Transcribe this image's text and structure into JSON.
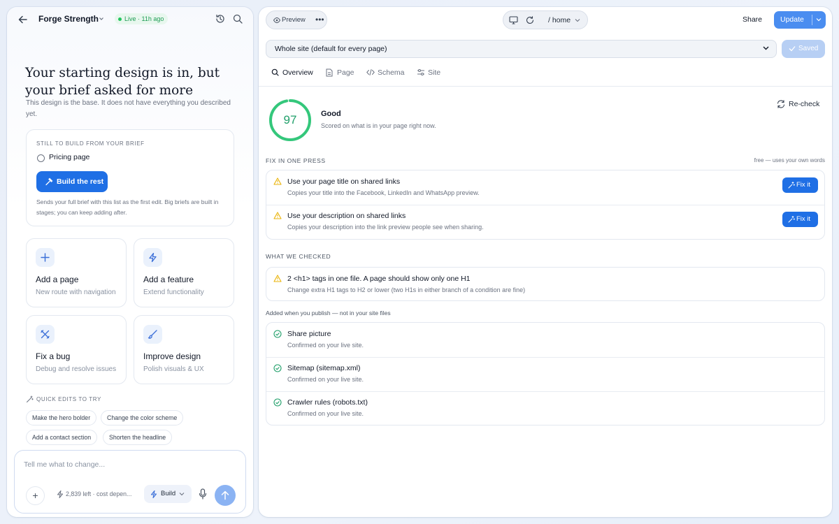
{
  "left": {
    "project_name": "Forge Strength",
    "live_badge": "Live · 11h ago",
    "heading": "Your starting design is in, but your brief asked for more",
    "subtext": "This design is the base. It does not have everything you described yet.",
    "todo": {
      "header": "STILL TO BUILD FROM YOUR BRIEF",
      "item": "Pricing page",
      "button": "Build the rest",
      "note": "Sends your full brief with this list as the first edit. Big briefs are built in stages; you can keep adding after."
    },
    "cards": [
      {
        "title": "Add a page",
        "subtitle": "New route with navigation",
        "icon": "plus-icon"
      },
      {
        "title": "Add a feature",
        "subtitle": "Extend functionality",
        "icon": "lightning-icon"
      },
      {
        "title": "Fix a bug",
        "subtitle": "Debug and resolve issues",
        "icon": "tools-icon"
      },
      {
        "title": "Improve design",
        "subtitle": "Polish visuals & UX",
        "icon": "brush-icon"
      }
    ],
    "quick_header": "QUICK EDITS TO TRY",
    "quick_edits": [
      "Make the hero bolder",
      "Change the color scheme",
      "Add a contact section",
      "Shorten the headline"
    ],
    "composer": {
      "placeholder": "Tell me what to change...",
      "credits": "2,839 left · cost depen...",
      "mode": "Build"
    }
  },
  "right": {
    "preview_label": "Preview",
    "route": "/ home",
    "share": "Share",
    "update": "Update",
    "scope_select": "Whole site (default for every page)",
    "saved": "Saved",
    "tabs": [
      {
        "label": "Overview",
        "icon": "search-icon"
      },
      {
        "label": "Page",
        "icon": "document-icon"
      },
      {
        "label": "Schema",
        "icon": "code-icon"
      },
      {
        "label": "Site",
        "icon": "sliders-icon"
      }
    ],
    "score": {
      "value": 97,
      "max": 100,
      "rating": "Good",
      "caption": "Scored on what is in your page right now."
    },
    "recheck": "Re-check",
    "fix_section": {
      "header": "FIX IN ONE PRESS",
      "note": "free — uses your own words",
      "items": [
        {
          "title": "Use your page title on shared links",
          "desc": "Copies your title into the Facebook, LinkedIn and WhatsApp preview.",
          "action": "Fix it"
        },
        {
          "title": "Use your description on shared links",
          "desc": "Copies your description into the link preview people see when sharing.",
          "action": "Fix it"
        }
      ]
    },
    "checked_section": {
      "header": "WHAT WE CHECKED",
      "items": [
        {
          "title": "2 <h1> tags in one file. A page should show only one H1",
          "desc": "Change extra H1 tags to H2 or lower (two H1s in either branch of a condition are fine)"
        }
      ]
    },
    "publish_note": "Added when you publish — not in your site files",
    "publish_items": [
      {
        "title": "Share picture",
        "desc": "Confirmed on your live site."
      },
      {
        "title": "Sitemap (sitemap.xml)",
        "desc": "Confirmed on your live site."
      },
      {
        "title": "Crawler rules (robots.txt)",
        "desc": "Confirmed on your live site."
      }
    ]
  },
  "colors": {
    "accent": "#1f6fe5",
    "success": "#22a06b",
    "warning": "#eab308",
    "live": "#22c55e"
  }
}
